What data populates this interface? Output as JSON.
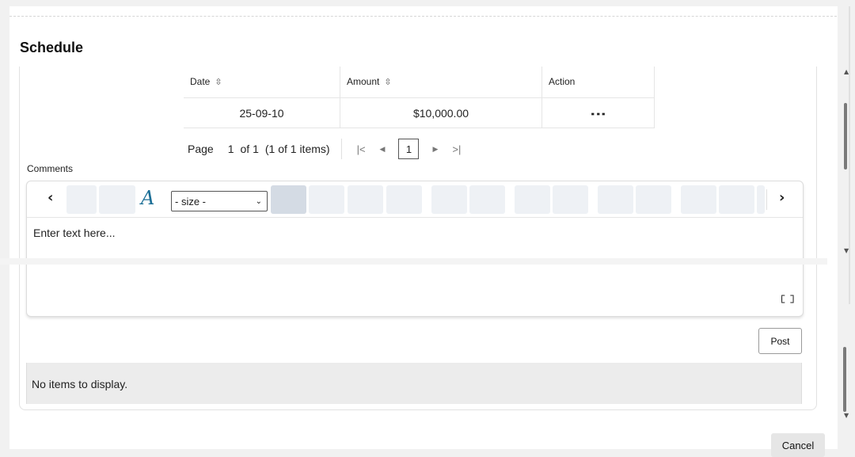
{
  "section_title": "Schedule",
  "table": {
    "headers": [
      "Date",
      "Amount",
      "Action"
    ],
    "rows": [
      {
        "date": "25-09-10",
        "amount": "$10,000.00",
        "action_icon": "kebab-menu-icon"
      }
    ]
  },
  "pager": {
    "page_label": "Page",
    "current_page": "1",
    "of_label": "of 1",
    "items_summary": "(1 of 1 items)",
    "page_box": "1"
  },
  "comments": {
    "label": "Comments",
    "font_size_select": "- size -",
    "placeholder": "Enter text here...",
    "post_label": "Post"
  },
  "empty_message": "No items to display.",
  "cancel_label": "Cancel"
}
